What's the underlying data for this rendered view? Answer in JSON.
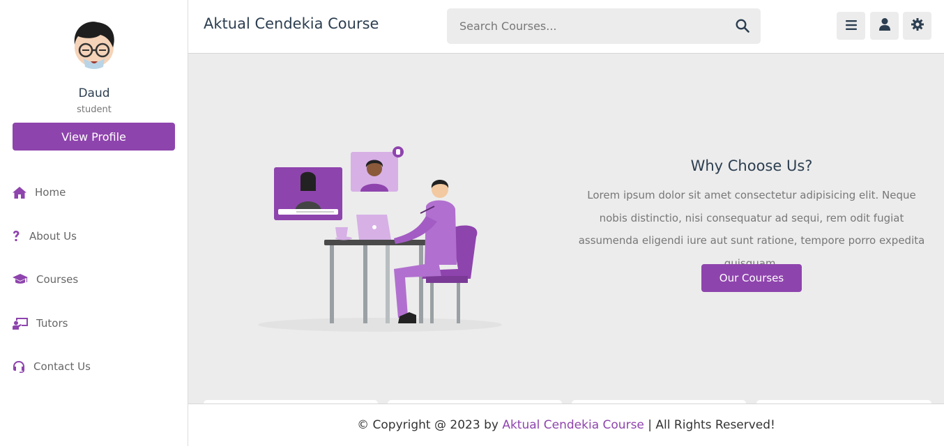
{
  "sidebar": {
    "user_name": "Daud",
    "user_role": "student",
    "view_profile_label": "View Profile",
    "nav": [
      {
        "label": "Home",
        "icon": "home-icon"
      },
      {
        "label": "About Us",
        "icon": "question-icon"
      },
      {
        "label": "Courses",
        "icon": "graduation-cap-icon"
      },
      {
        "label": "Tutors",
        "icon": "chalkboard-teacher-icon"
      },
      {
        "label": "Contact Us",
        "icon": "headset-icon"
      }
    ]
  },
  "header": {
    "logo": "Aktual Cendekia Course",
    "search_placeholder": "Search Courses...",
    "buttons": [
      "menu-icon",
      "user-icon",
      "settings-icon"
    ]
  },
  "hero": {
    "title": "Why Choose Us?",
    "text": "Lorem ipsum dolor sit amet consectetur adipisicing elit. Neque nobis distinctio, nisi consequatur ad sequi, rem odit fugiat assumenda eligendi iure aut sunt ratione, tempore porro expedita quisquam.",
    "button_label": "Our Courses"
  },
  "footer": {
    "prefix": "© Copyright @ 2023 by ",
    "brand": "Aktual Cendekia Course",
    "suffix": " | All Rights Reserved!"
  },
  "colors": {
    "accent": "#8e44ad",
    "text_dark": "#2c3e50",
    "background": "#ececec"
  }
}
